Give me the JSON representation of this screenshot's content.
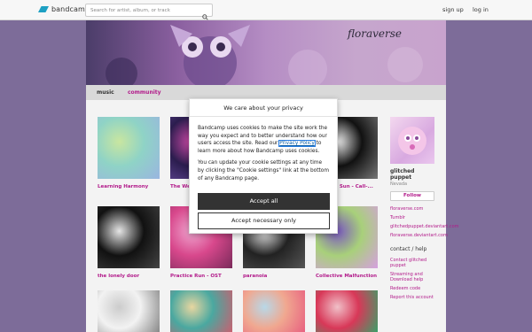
{
  "topbar": {
    "logo_text": "bandcamp",
    "search_placeholder": "Search for artist, album, or track",
    "signup": "sign up",
    "login": "log in"
  },
  "band": {
    "banner_title": "floraverse",
    "tabs": [
      {
        "label": "music"
      },
      {
        "label": "community"
      }
    ]
  },
  "releases": [
    {
      "title": "Learning Harmony",
      "colors": [
        "#8fd3c6",
        "#c9e6a0",
        "#9ab5e0"
      ]
    },
    {
      "title": "The Wel... glitchedp...",
      "colors": [
        "#2b1d4e",
        "#d04aa8",
        "#6a4ea0"
      ]
    },
    {
      "title": "",
      "colors": [
        "#e0d0b0",
        "#c8a0c8",
        "#a080a0"
      ]
    },
    {
      "title": "Cracked Sun - Call-... OST 1",
      "colors": [
        "#111111",
        "#f0f0f0",
        "#777777"
      ]
    },
    {
      "title": "the lonely door",
      "colors": [
        "#111111",
        "#e6e6e6",
        "#444444"
      ]
    },
    {
      "title": "Practice Run - OST",
      "colors": [
        "#d8488c",
        "#f0a6d0",
        "#7a2a5a"
      ]
    },
    {
      "title": "paranoia",
      "colors": [
        "#222222",
        "#e8e8e8",
        "#555555"
      ]
    },
    {
      "title": "Collective Malfunction",
      "colors": [
        "#a8d07a",
        "#7a58c0",
        "#d6a0e0"
      ]
    },
    {
      "title": "",
      "colors": [
        "#f2f2f2",
        "#cccccc",
        "#888888"
      ]
    },
    {
      "title": "",
      "colors": [
        "#4aa8a0",
        "#e8d6a0",
        "#c86070"
      ]
    },
    {
      "title": "",
      "colors": [
        "#f0a890",
        "#b8d8e8",
        "#e86080"
      ]
    },
    {
      "title": "",
      "colors": [
        "#d83858",
        "#f0c0c8",
        "#3aa068"
      ]
    }
  ],
  "sidebar": {
    "name": "glitched puppet",
    "location": "Nevada",
    "follow": "Follow",
    "links": [
      "floraverse.com",
      "Tumblr",
      "glitchedpuppet.deviantart.com",
      "floraverse.deviantart.com"
    ],
    "contact_head": "contact / help",
    "contact_links": [
      "Contact glitched puppet",
      "Streaming and Download help",
      "Redeem code",
      "Report this account"
    ]
  },
  "dialog": {
    "title": "We care about your privacy",
    "text1_a": "Bandcamp uses cookies to make the site work the way you expect and to better understand how our users access the site. Read our",
    "link": "Privacy Policy",
    "text1_b": "to learn more about how Bandcamp uses cookies.",
    "text2": "You can update your cookie settings at any time by clicking the \"Cookie settings\" link at the bottom of any Bandcamp page.",
    "accept_all": "Accept all",
    "accept_necessary": "Accept necessary only"
  }
}
